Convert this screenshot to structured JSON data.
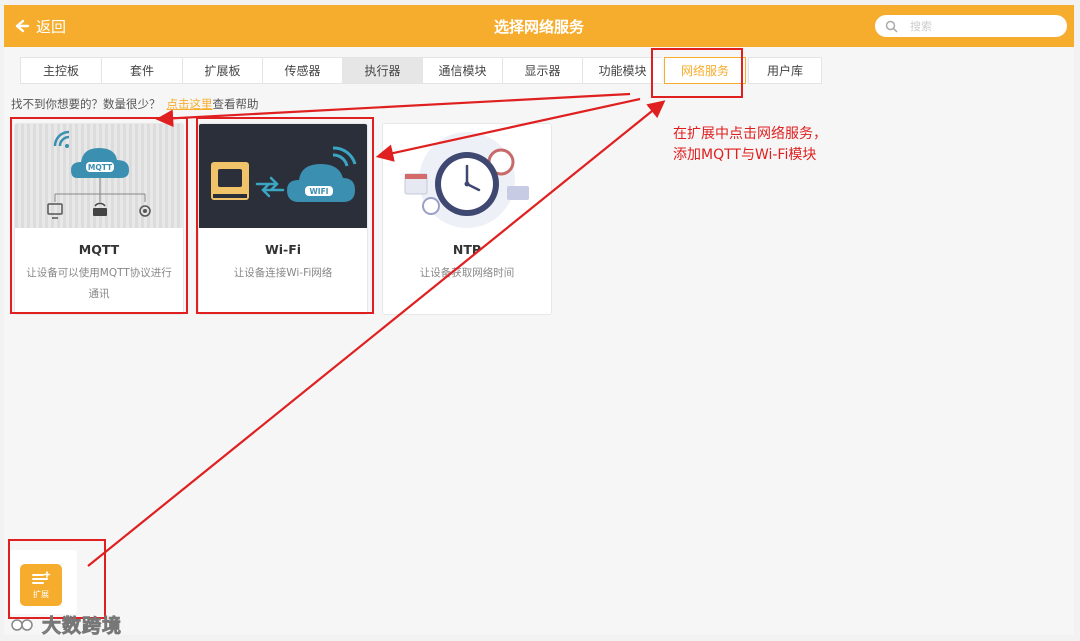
{
  "header": {
    "back_label": "返回",
    "title": "选择网络服务",
    "search_placeholder": "搜索"
  },
  "tabs": [
    {
      "label": "主控板"
    },
    {
      "label": "套件"
    },
    {
      "label": "扩展板"
    },
    {
      "label": "传感器"
    },
    {
      "label": "执行器"
    },
    {
      "label": "通信模块"
    },
    {
      "label": "显示器"
    },
    {
      "label": "功能模块"
    },
    {
      "label": "网络服务",
      "active": true
    },
    {
      "label": "用户库"
    }
  ],
  "hint": {
    "text": "找不到你想要的？数量很少？",
    "link": "点击这里",
    "suffix": "查看帮助"
  },
  "cards": [
    {
      "name": "MQTT",
      "desc": "让设备可以使用MQTT协议进行通讯",
      "badge": "MQTT"
    },
    {
      "name": "Wi-Fi",
      "desc": "让设备连接Wi-Fi网络",
      "badge": "WIFI"
    },
    {
      "name": "NTP",
      "desc": "让设备获取网络时间"
    }
  ],
  "annotation": {
    "note": "在扩展中点击网络服务，\n添加MQTT与Wi-Fi模块"
  },
  "extension": {
    "label": "扩展"
  },
  "watermark": {
    "text": "大数跨境"
  },
  "colors": {
    "accent": "#f6ad2e",
    "annotation": "#e02020",
    "cloud": "#3b8fb0"
  }
}
